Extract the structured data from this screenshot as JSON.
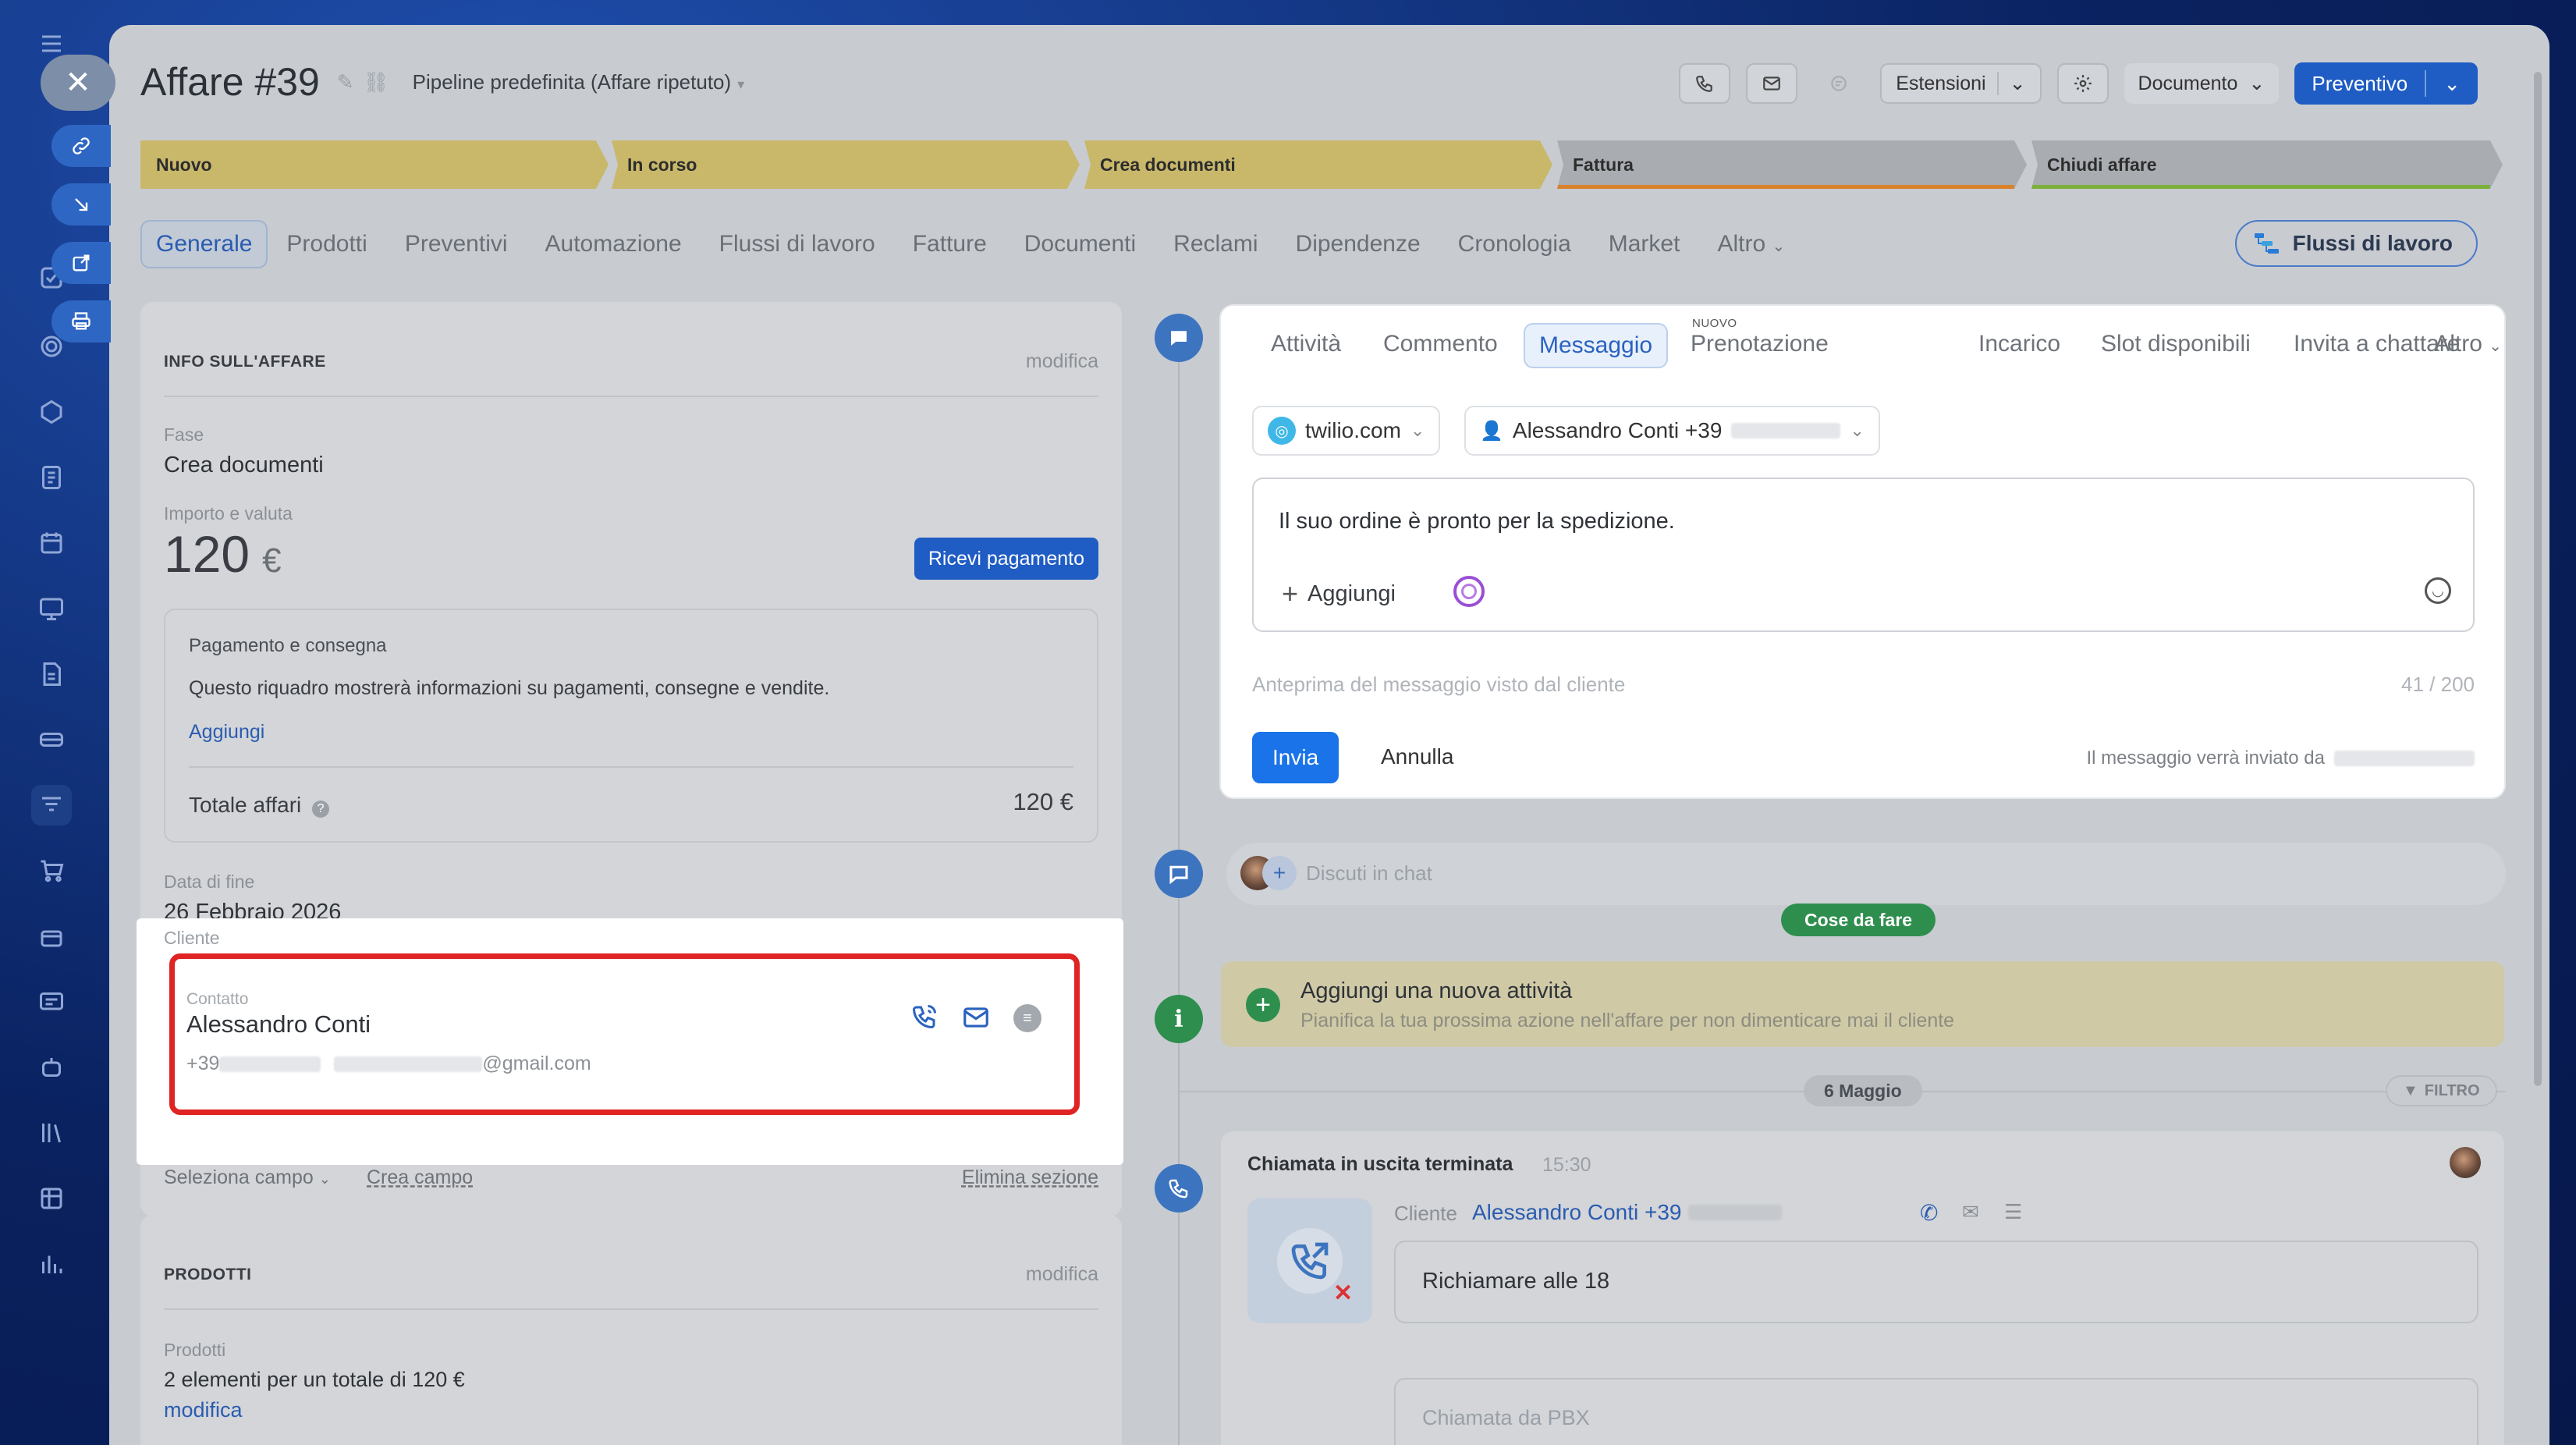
{
  "deal": {
    "title": "Affare #39",
    "pipeline": "Pipeline predefinita (Affare ripetuto)"
  },
  "header_buttons": {
    "estensioni": "Estensioni",
    "documento": "Documento",
    "preventivo": "Preventivo"
  },
  "stages": [
    {
      "label": "Nuovo",
      "color": "#c9b86a"
    },
    {
      "label": "In corso",
      "color": "#c9b86a"
    },
    {
      "label": "Crea documenti",
      "color": "#c9b86a"
    },
    {
      "label": "Fattura",
      "color": "#a9adb2"
    },
    {
      "label": "Chiudi affare",
      "color": "#a9adb2"
    }
  ],
  "tabs": [
    "Generale",
    "Prodotti",
    "Preventivi",
    "Automazione",
    "Flussi di lavoro",
    "Fatture",
    "Documenti",
    "Reclami",
    "Dipendenze",
    "Cronologia",
    "Market",
    "Altro"
  ],
  "flussi_button": "Flussi di lavoro",
  "info": {
    "title": "INFO SULL'AFFARE",
    "edit": "modifica",
    "fase_label": "Fase",
    "fase_value": "Crea documenti",
    "importo_label": "Importo e valuta",
    "amount": "120",
    "currency": "€",
    "ricevi": "Ricevi pagamento",
    "pagamento_title": "Pagamento e consegna",
    "pagamento_text": "Questo riquadro mostrerà informazioni su pagamenti, consegne e vendite.",
    "aggiungi": "Aggiungi",
    "totale_label": "Totale affari",
    "totale_value": "120 €",
    "data_fine_label": "Data di fine",
    "data_fine_value": "26 Febbraio 2026",
    "cliente_label": "Cliente",
    "contatto_label": "Contatto",
    "contact_name": "Alessandro Conti",
    "phone_prefix": "+39",
    "email_suffix": "@gmail.com",
    "seleziona": "Seleziona campo",
    "crea_campo": "Crea campo",
    "elimina": "Elimina sezione"
  },
  "prodotti": {
    "title": "PRODOTTI",
    "edit": "modifica",
    "label": "Prodotti",
    "summary": "2 elementi per un totale di 120 €",
    "edit_link": "modifica"
  },
  "composer": {
    "tabs": [
      "Attività",
      "Commento",
      "Messaggio",
      "Prenotazione",
      "Incarico",
      "Slot disponibili",
      "Invita a chattare",
      "Altro"
    ],
    "nuovo_badge": "NUOVO",
    "provider": "twilio.com",
    "recipient": "Alessandro Conti +39",
    "message": "Il suo ordine è pronto per la spedizione.",
    "aggiungi": "Aggiungi",
    "preview": "Anteprima del messaggio visto dal cliente",
    "counter": "41 / 200",
    "send": "Invia",
    "cancel": "Annulla",
    "sender_note": "Il messaggio verrà inviato da"
  },
  "timeline": {
    "chat_placeholder": "Discuti in chat",
    "todo_pill": "Cose da fare",
    "new_activity_title": "Aggiungi una nuova attività",
    "new_activity_sub": "Pianifica la tua prossima azione nell'affare per non dimenticare mai il cliente",
    "date_pill": "6 Maggio",
    "filter": "FILTRO",
    "call_title": "Chiamata in uscita terminata",
    "call_time": "15:30",
    "call_client_label": "Cliente",
    "call_client_name": "Alessandro Conti +39",
    "call_note": "Richiamare alle 18",
    "call_source": "Chiamata da PBX"
  }
}
